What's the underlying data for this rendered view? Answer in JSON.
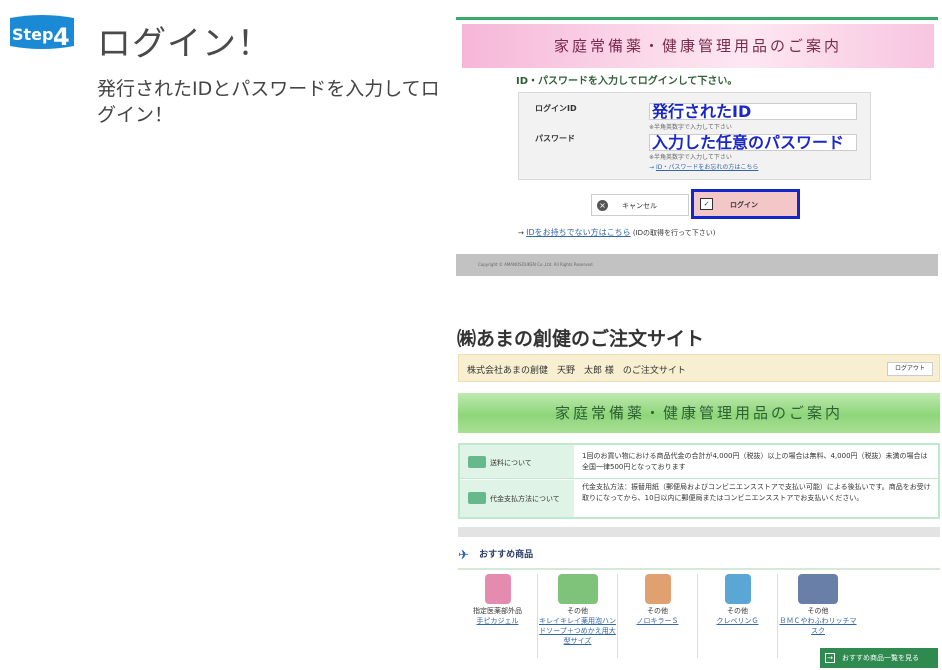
{
  "step": {
    "badge_word": "Step",
    "badge_num": "4",
    "title": "ログイン！",
    "description": "発行されたIDとパスワードを入力してログイン！"
  },
  "login": {
    "banner": "家庭常備薬・健康管理用品のご案内",
    "lead": "ID・パスワードを入力してログインして下さい。",
    "id_label": "ログインID",
    "id_value": "発行されたID",
    "id_hint": "※半角英数字で入力して下さい",
    "pw_label": "パスワード",
    "pw_value": "入力した任意のパスワード",
    "pw_hint": "※半角英数字で入力して下さい",
    "forgot_arrow": "→",
    "forgot_link": "ID・パスワードをお忘れの方はこちら",
    "cancel_label": "キャンセル",
    "login_label": "ログイン",
    "noid_arrow": "→",
    "noid_link": "IDをお持ちでない方はこちら",
    "noid_note": "(IDの取得を行って下さい)",
    "footer": "Copyright © AMANOSOUKEN Co.,Ltd. All Rights Reserved."
  },
  "site": {
    "title": "㈱あまの創健のご注文サイト",
    "header_text": "株式会社あまの創健　天野　太郎 様　のご注文サイト",
    "logout_label": "ログアウト",
    "banner": "家庭常備薬・健康管理用品のご案内",
    "info": [
      {
        "label": "送料について",
        "text": "1回のお買い物における商品代金の合計が4,000円（税抜）以上の場合は無料、4,000円（税抜）未満の場合は全国一律500円となっております"
      },
      {
        "label": "代金支払方法について",
        "text": "代金支払方法：振替用紙（郵便局およびコンビニエンスストアで支払い可能）による後払いです。商品をお受け取りになってから、10日以内に郵便局またはコンビニエンスストアでお支払いください。"
      }
    ],
    "recommend_title": "おすすめ商品",
    "products": [
      {
        "category": "指定医薬部外品",
        "name": "手ピカジェル",
        "color": "#e58bb0"
      },
      {
        "category": "その他",
        "name": "キレイキレイ薬用泡ハンドソープ＋つめかえ用大型サイズ",
        "color": "#7fc27a"
      },
      {
        "category": "その他",
        "name": "ノロキラーＳ",
        "color": "#e0a070"
      },
      {
        "category": "その他",
        "name": "クレベリンＧ",
        "color": "#5aa7d6"
      },
      {
        "category": "その他",
        "name": "ＢＭＣやわふわリッチマスク",
        "color": "#6a7fa8"
      }
    ],
    "recommend_all": "おすすめ商品一覧を見る"
  },
  "colors": {
    "accent_blue": "#1426c8",
    "green": "#2f8a4f",
    "pink_banner": "#f6b6d8"
  }
}
